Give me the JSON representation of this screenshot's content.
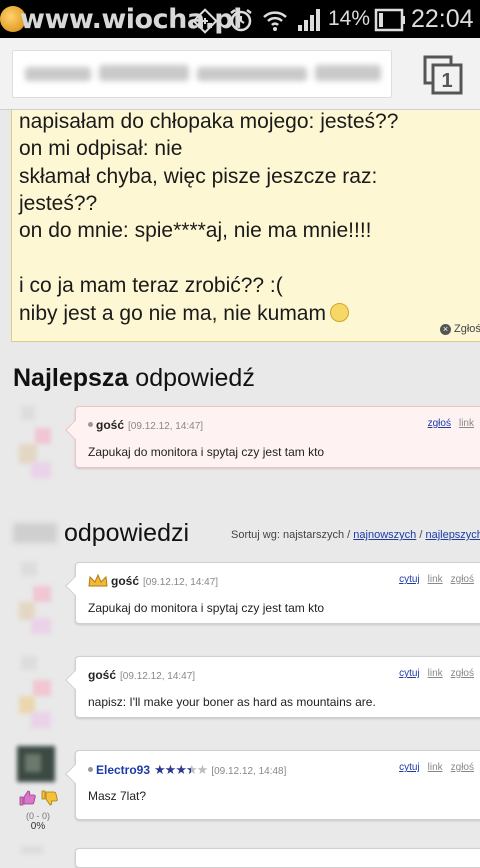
{
  "watermark": "www.wiocha.pl",
  "status_bar": {
    "battery": "14%",
    "time": "22:04"
  },
  "address_bar": {
    "tab_count": "1"
  },
  "post": {
    "lines": [
      "napisałam do chłopaka mojego: jesteś??",
      "on mi odpisał: nie",
      "skłamał chyba, więc pisze jeszcze raz:",
      "jesteś??",
      "on do mnie: spie****aj, nie ma mnie!!!!",
      "i co ja mam teraz zrobić?? :(",
      "niby jest a go nie ma, nie kumam"
    ],
    "report": "Zgłoś"
  },
  "best_answer": {
    "title_bold": "Najlepsza",
    "title_rest": "odpowiedź"
  },
  "other_answers": {
    "title_rest": "odpowiedzi"
  },
  "sort": {
    "label": "Sortuj wg:",
    "oldest": "najstarszych",
    "newest": "najnowszych",
    "best": "najlepszych"
  },
  "comments": [
    {
      "author": "gość",
      "date": "[09.12.12, 14:47]",
      "text": "Zapukaj do monitora i spytaj czy jest tam kto",
      "actions": [
        "zgłoś",
        "link"
      ]
    },
    {
      "author": "gość",
      "date": "[09.12.12, 14:47]",
      "text": "Zapukaj do monitora i spytaj czy jest tam kto",
      "actions": [
        "cytuj",
        "link",
        "zgłoś"
      ]
    },
    {
      "author": "gość",
      "date": "[09.12.12, 14:47]",
      "text": "napisz: I'll make your boner as hard as mountains are.",
      "actions": [
        "cytuj",
        "link",
        "zgłoś"
      ]
    },
    {
      "author": "Electro93",
      "date": "[09.12.12, 14:48]",
      "text": "Masz 7lat?",
      "actions": [
        "cytuj",
        "link",
        "zgłoś"
      ],
      "rating": 3.5
    }
  ],
  "vote": {
    "count": "(0 - 0)",
    "percent": "0%"
  },
  "colors": {
    "accent": "#1c3aa8",
    "post_bg": "#fdf7d4"
  }
}
